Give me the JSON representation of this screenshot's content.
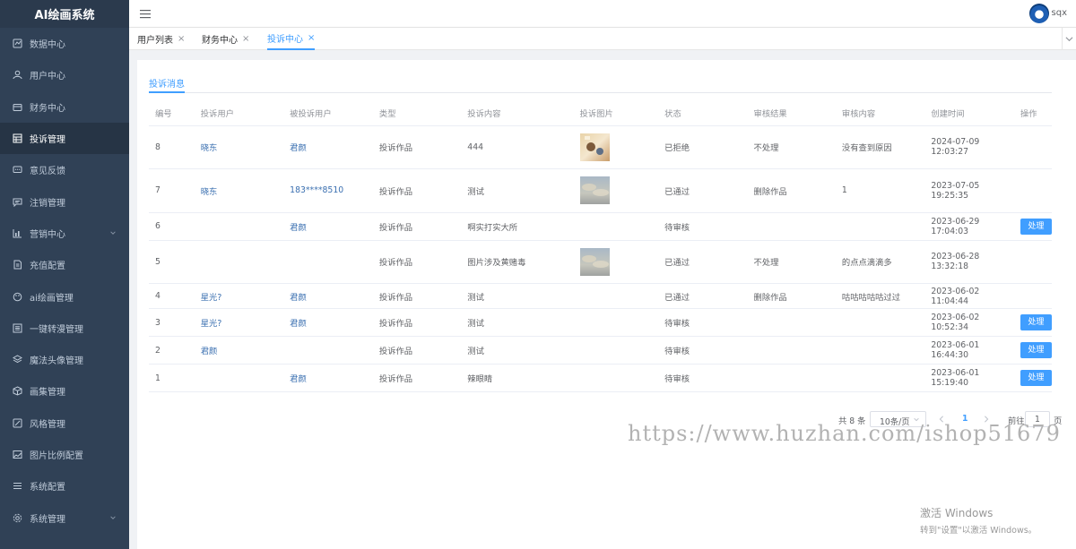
{
  "app": {
    "title": "AI绘画系统"
  },
  "sidebar": {
    "items": [
      {
        "label": "数据中心",
        "icon": "dashboard-icon",
        "active": false
      },
      {
        "label": "用户中心",
        "icon": "user-icon",
        "active": false
      },
      {
        "label": "财务中心",
        "icon": "wallet-icon",
        "active": false
      },
      {
        "label": "投诉管理",
        "icon": "table-icon",
        "active": true
      },
      {
        "label": "意见反馈",
        "icon": "message-icon",
        "active": false
      },
      {
        "label": "注销管理",
        "icon": "chat-icon",
        "active": false
      },
      {
        "label": "营销中心",
        "icon": "chart-icon",
        "active": false,
        "has_children": true
      },
      {
        "label": "充值配置",
        "icon": "document-icon",
        "active": false
      },
      {
        "label": "ai绘画管理",
        "icon": "palette-icon",
        "active": false
      },
      {
        "label": "一键转漫管理",
        "icon": "list-icon",
        "active": false
      },
      {
        "label": "魔法头像管理",
        "icon": "layers-icon",
        "active": false
      },
      {
        "label": "画集管理",
        "icon": "cube-icon",
        "active": false
      },
      {
        "label": "风格管理",
        "icon": "edit-icon",
        "active": false
      },
      {
        "label": "图片比例配置",
        "icon": "image-icon",
        "active": false
      },
      {
        "label": "系统配置",
        "icon": "menu-icon",
        "active": false
      },
      {
        "label": "系统管理",
        "icon": "gear-icon",
        "active": false,
        "has_children": true
      }
    ]
  },
  "header": {
    "username": "sqx"
  },
  "tabs": [
    {
      "label": "用户列表",
      "close": "×",
      "active": false
    },
    {
      "label": "财务中心",
      "close": "×",
      "active": false
    },
    {
      "label": "投诉中心",
      "close": "×",
      "active": true
    }
  ],
  "subtab": {
    "label": "投诉消息"
  },
  "table": {
    "columns": [
      "编号",
      "投诉用户",
      "被投诉用户",
      "类型",
      "投诉内容",
      "投诉图片",
      "状态",
      "审核结果",
      "审核内容",
      "创建时间",
      "操作"
    ],
    "rows": [
      {
        "id": "8",
        "complainant": "晓东",
        "target": "君颜",
        "type": "投诉作品",
        "content": "444",
        "image": "sunset",
        "status": "已拒绝",
        "result": "不处理",
        "review": "没有查到原因",
        "created": "2024-07-09 12:03:27",
        "action": ""
      },
      {
        "id": "7",
        "complainant": "晓东",
        "target": "183****8510",
        "type": "投诉作品",
        "content": "测试",
        "image": "sky",
        "status": "已通过",
        "result": "删除作品",
        "review": "1",
        "created": "2023-07-05 19:25:35",
        "action": ""
      },
      {
        "id": "6",
        "complainant": "",
        "target": "君颜",
        "type": "投诉作品",
        "content": "啊实打实大所",
        "image": "",
        "status": "待审核",
        "result": "",
        "review": "",
        "created": "2023-06-29 17:04:03",
        "action": "处理"
      },
      {
        "id": "5",
        "complainant": "",
        "target": "",
        "type": "投诉作品",
        "content": "图片涉及黄赌毒",
        "image": "sky",
        "status": "已通过",
        "result": "不处理",
        "review": "的点点滴滴多",
        "created": "2023-06-28 13:32:18",
        "action": ""
      },
      {
        "id": "4",
        "complainant": "星光?",
        "target": "君颜",
        "type": "投诉作品",
        "content": "测试",
        "image": "",
        "status": "已通过",
        "result": "删除作品",
        "review": "咕咕咕咕咕过过",
        "created": "2023-06-02 11:04:44",
        "action": ""
      },
      {
        "id": "3",
        "complainant": "星光?",
        "target": "君颜",
        "type": "投诉作品",
        "content": "测试",
        "image": "",
        "status": "待审核",
        "result": "",
        "review": "",
        "created": "2023-06-02 10:52:34",
        "action": "处理"
      },
      {
        "id": "2",
        "complainant": "君颜",
        "target": "",
        "type": "投诉作品",
        "content": "测试",
        "image": "",
        "status": "待审核",
        "result": "",
        "review": "",
        "created": "2023-06-01 16:44:30",
        "action": "处理"
      },
      {
        "id": "1",
        "complainant": "",
        "target": "君颜",
        "type": "投诉作品",
        "content": "辣眼睛",
        "image": "",
        "status": "待审核",
        "result": "",
        "review": "",
        "created": "2023-06-01 15:19:40",
        "action": "处理"
      }
    ]
  },
  "pagination": {
    "total_text": "共 8 条",
    "page_size": "10条/页",
    "current_page": "1",
    "goto_prefix": "前往",
    "goto_value": "1",
    "goto_suffix": "页"
  },
  "watermark": "https://www.huzhan.com/ishop51679",
  "os_notice": {
    "title": "激活 Windows",
    "subtitle": "转到\"设置\"以激活 Windows。"
  },
  "colors": {
    "sidebar_bg": "#304156",
    "accent": "#409eff",
    "link": "#3a6fb0"
  }
}
